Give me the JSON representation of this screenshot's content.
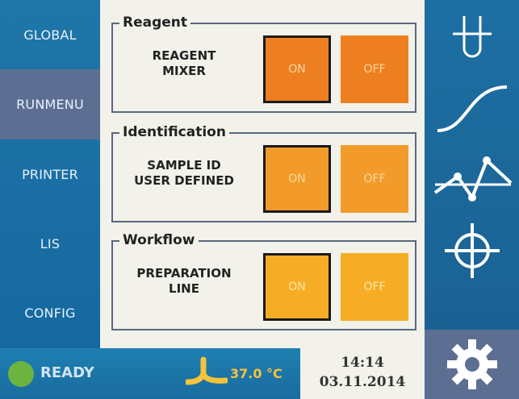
{
  "nav": {
    "items": [
      {
        "label": "GLOBAL",
        "active": false
      },
      {
        "label": "RUNMENU",
        "active": true
      },
      {
        "label": "PRINTER",
        "active": false
      },
      {
        "label": "LIS",
        "active": false
      },
      {
        "label": "CONFIG",
        "active": false
      }
    ]
  },
  "groups": [
    {
      "title": "Reagent",
      "label_line1": "REAGENT",
      "label_line2": "MIXER",
      "on_label": "ON",
      "off_label": "OFF",
      "selected": "ON"
    },
    {
      "title": "Identification",
      "label_line1": "SAMPLE ID",
      "label_line2": "USER DEFINED",
      "on_label": "ON",
      "off_label": "OFF",
      "selected": "ON"
    },
    {
      "title": "Workflow",
      "label_line1": "PREPARATION",
      "label_line2": "LINE",
      "on_label": "ON",
      "off_label": "OFF",
      "selected": "ON"
    }
  ],
  "right_nav": {
    "icons": [
      "test-tube-icon",
      "curve-icon",
      "graph-points-icon",
      "crosshair-icon",
      "gear-icon"
    ]
  },
  "status": {
    "ready_label": "READY",
    "temperature": "37.0 °C",
    "time": "14:14",
    "date": "03.11.2014"
  },
  "colors": {
    "nav_blue": "#1f76a8",
    "nav_active": "#5c6f92",
    "panel_bg": "#f2f1ea",
    "orange_dark": "#ee7f20",
    "orange_mid": "#f39b2a",
    "orange_light": "#f6ad25",
    "ready_green": "#6db33f",
    "temp_yellow": "#f6c33a"
  }
}
